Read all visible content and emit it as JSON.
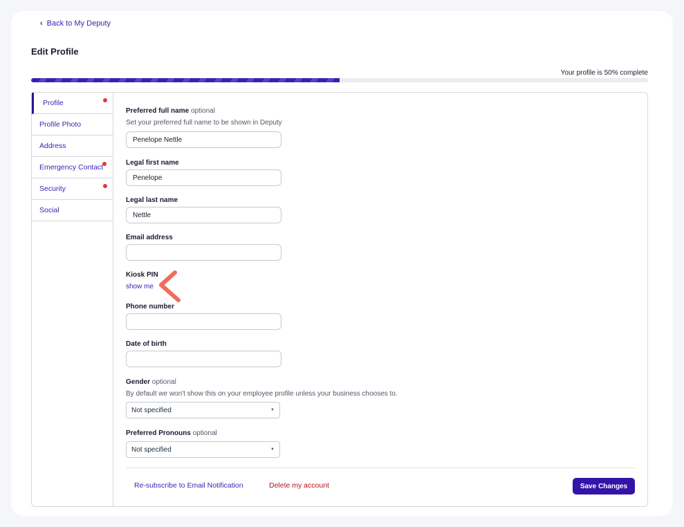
{
  "nav": {
    "back_label": "Back to My Deputy"
  },
  "page": {
    "title": "Edit Profile"
  },
  "progress": {
    "label": "Your profile is 50% complete",
    "percent": 50
  },
  "colors": {
    "accent": "#3413a8",
    "danger": "#b3121b",
    "alert_dot": "#e8343a",
    "annotation": "#f26b5b"
  },
  "sidebar": {
    "items": [
      {
        "label": "Profile",
        "active": true,
        "alert": true
      },
      {
        "label": "Profile Photo",
        "active": false,
        "alert": false
      },
      {
        "label": "Address",
        "active": false,
        "alert": false
      },
      {
        "label": "Emergency Contact",
        "active": false,
        "alert": true
      },
      {
        "label": "Security",
        "active": false,
        "alert": true
      },
      {
        "label": "Social",
        "active": false,
        "alert": false
      }
    ]
  },
  "form": {
    "preferred_name": {
      "label": "Preferred full name",
      "optional": "optional",
      "help": "Set your preferred full name to be shown in Deputy",
      "value": "Penelope Nettle"
    },
    "first_name": {
      "label": "Legal first name",
      "value": "Penelope"
    },
    "last_name": {
      "label": "Legal last name",
      "value": "Nettle"
    },
    "email": {
      "label": "Email address",
      "value": ""
    },
    "kiosk_pin": {
      "label": "Kiosk PIN",
      "link": "show me"
    },
    "phone": {
      "label": "Phone number",
      "value": ""
    },
    "dob": {
      "label": "Date of birth",
      "value": ""
    },
    "gender": {
      "label": "Gender",
      "optional": "optional",
      "help": "By default we won't show this on your employee profile unless your business chooses to.",
      "value": "Not specified"
    },
    "pronouns": {
      "label": "Preferred Pronouns",
      "optional": "optional",
      "value": "Not specified"
    }
  },
  "footer": {
    "resubscribe": "Re-subscribe to Email Notification",
    "delete": "Delete my account",
    "save": "Save Changes"
  }
}
